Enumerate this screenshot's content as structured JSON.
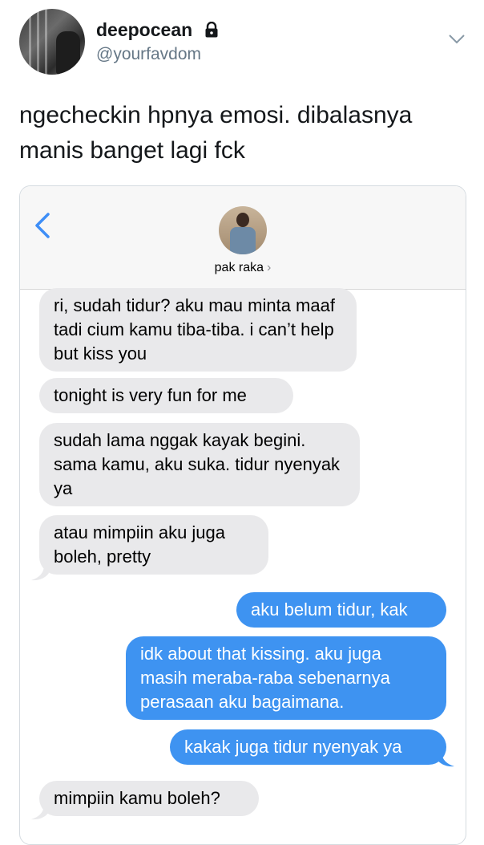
{
  "tweet": {
    "display_name": "deepocean",
    "handle": "@yourfavdom",
    "text": "ngecheckin hpnya emosi. dibalasnya manis banget lagi fck",
    "icons": {
      "lock": "lock-icon",
      "menu": "chevron-down-icon"
    }
  },
  "imessage": {
    "contact_name": "pak raka",
    "contact_chevron": "›",
    "icons": {
      "back": "back-icon"
    },
    "colors": {
      "incoming": "#e9e9eb",
      "outgoing": "#3e93f1"
    },
    "messages": [
      {
        "from": "them",
        "text": "ri, sudah tidur? aku mau minta maaf tadi cium kamu tiba-tiba. i can’t help but kiss you"
      },
      {
        "from": "them",
        "text": "tonight is very fun for me"
      },
      {
        "from": "them",
        "text": "sudah lama nggak kayak begini. sama kamu, aku suka. tidur nyenyak ya"
      },
      {
        "from": "them",
        "text": "atau mimpiin aku juga boleh, pretty"
      },
      {
        "from": "me",
        "text": "aku belum tidur, kak"
      },
      {
        "from": "me",
        "text": "idk about that kissing. aku juga masih meraba-raba sebenarnya perasaan aku bagaimana."
      },
      {
        "from": "me",
        "text": "kakak juga tidur nyenyak ya"
      },
      {
        "from": "them",
        "text": "mimpiin kamu boleh?"
      }
    ]
  }
}
